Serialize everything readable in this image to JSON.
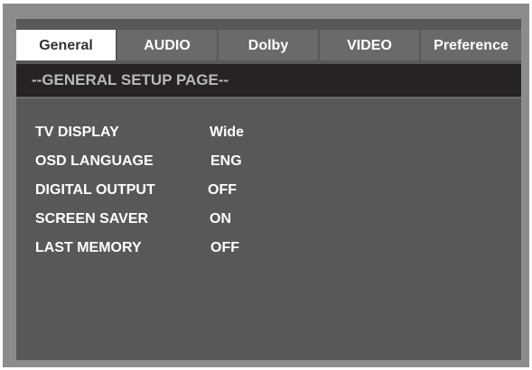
{
  "tabs": [
    {
      "label": "General",
      "active": true
    },
    {
      "label": "AUDIO",
      "active": false
    },
    {
      "label": "Dolby",
      "active": false
    },
    {
      "label": "VIDEO",
      "active": false
    },
    {
      "label": "Preference",
      "active": false
    }
  ],
  "page": {
    "title": "--GENERAL SETUP PAGE--"
  },
  "settings": [
    {
      "label": "TV DISPLAY",
      "value": "Wide"
    },
    {
      "label": "OSD LANGUAGE",
      "value": "ENG"
    },
    {
      "label": "DIGITAL OUTPUT",
      "value": "OFF"
    },
    {
      "label": "SCREEN SAVER",
      "value": "ON"
    },
    {
      "label": "LAST MEMORY",
      "value": "OFF"
    }
  ],
  "colors": {
    "frame": "#8c8c8c",
    "screen": "#585858",
    "header": "#272223",
    "tab_active": "#ffffff",
    "tab_inactive": "#6a6a6a"
  }
}
